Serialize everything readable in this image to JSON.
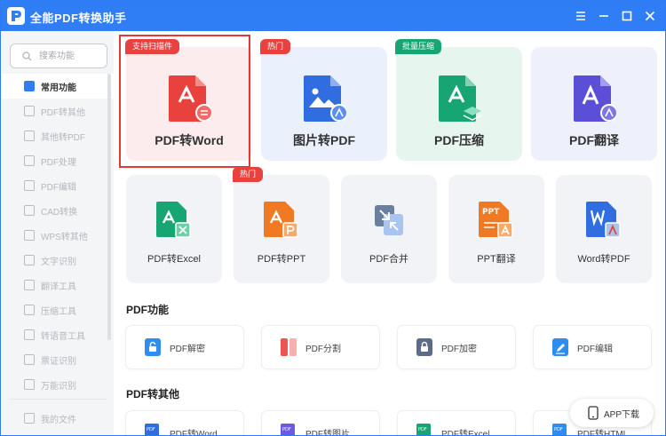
{
  "app": {
    "title": "全能PDF转换助手"
  },
  "sidebar": {
    "search_placeholder": "搜索功能",
    "items": [
      {
        "label": "常用功能"
      },
      {
        "label": "PDF转其他"
      },
      {
        "label": "其他转PDF"
      },
      {
        "label": "PDF处理"
      },
      {
        "label": "PDF编辑"
      },
      {
        "label": "CAD转换"
      },
      {
        "label": "WPS转其他"
      },
      {
        "label": "文字识别"
      },
      {
        "label": "翻译工具"
      },
      {
        "label": "压缩工具"
      },
      {
        "label": "转语音工具"
      },
      {
        "label": "票证识别"
      },
      {
        "label": "万能识别"
      }
    ],
    "bottom_item": "我的文件"
  },
  "featured": [
    {
      "label": "PDF转Word",
      "tag": "支持扫描件",
      "tag_color": "#e8413e",
      "bg": "#fdecee"
    },
    {
      "label": "图片转PDF",
      "tag": "热门",
      "tag_color": "#e8413e",
      "bg": "#eaf1fd"
    },
    {
      "label": "PDF压缩",
      "tag": "批量压缩",
      "tag_color": "#17a673",
      "bg": "#e6f6ef"
    },
    {
      "label": "PDF翻译",
      "tag": "",
      "tag_color": "",
      "bg": "#eef0fb"
    }
  ],
  "common": [
    {
      "label": "PDF转Excel",
      "tag": ""
    },
    {
      "label": "PDF转PPT",
      "tag": "热门"
    },
    {
      "label": "PDF合并",
      "tag": ""
    },
    {
      "label": "PPT翻译",
      "tag": ""
    },
    {
      "label": "Word转PDF",
      "tag": ""
    }
  ],
  "sections": {
    "pdf_functions": {
      "title": "PDF功能",
      "items": [
        {
          "label": "PDF解密"
        },
        {
          "label": "PDF分割"
        },
        {
          "label": "PDF加密"
        },
        {
          "label": "PDF编辑"
        }
      ]
    },
    "pdf_to_other": {
      "title": "PDF转其他",
      "items": [
        {
          "label": "PDF转Word"
        },
        {
          "label": "PDF转图片"
        },
        {
          "label": "PDF转Excel"
        },
        {
          "label": "PDF转HTML"
        }
      ]
    }
  },
  "app_download": {
    "label": "APP下载"
  },
  "colors": {
    "titlebar": "#2f7ef6",
    "accent_red": "#e8413e",
    "accent_green": "#17a673",
    "selection_border": "#e03a33"
  }
}
